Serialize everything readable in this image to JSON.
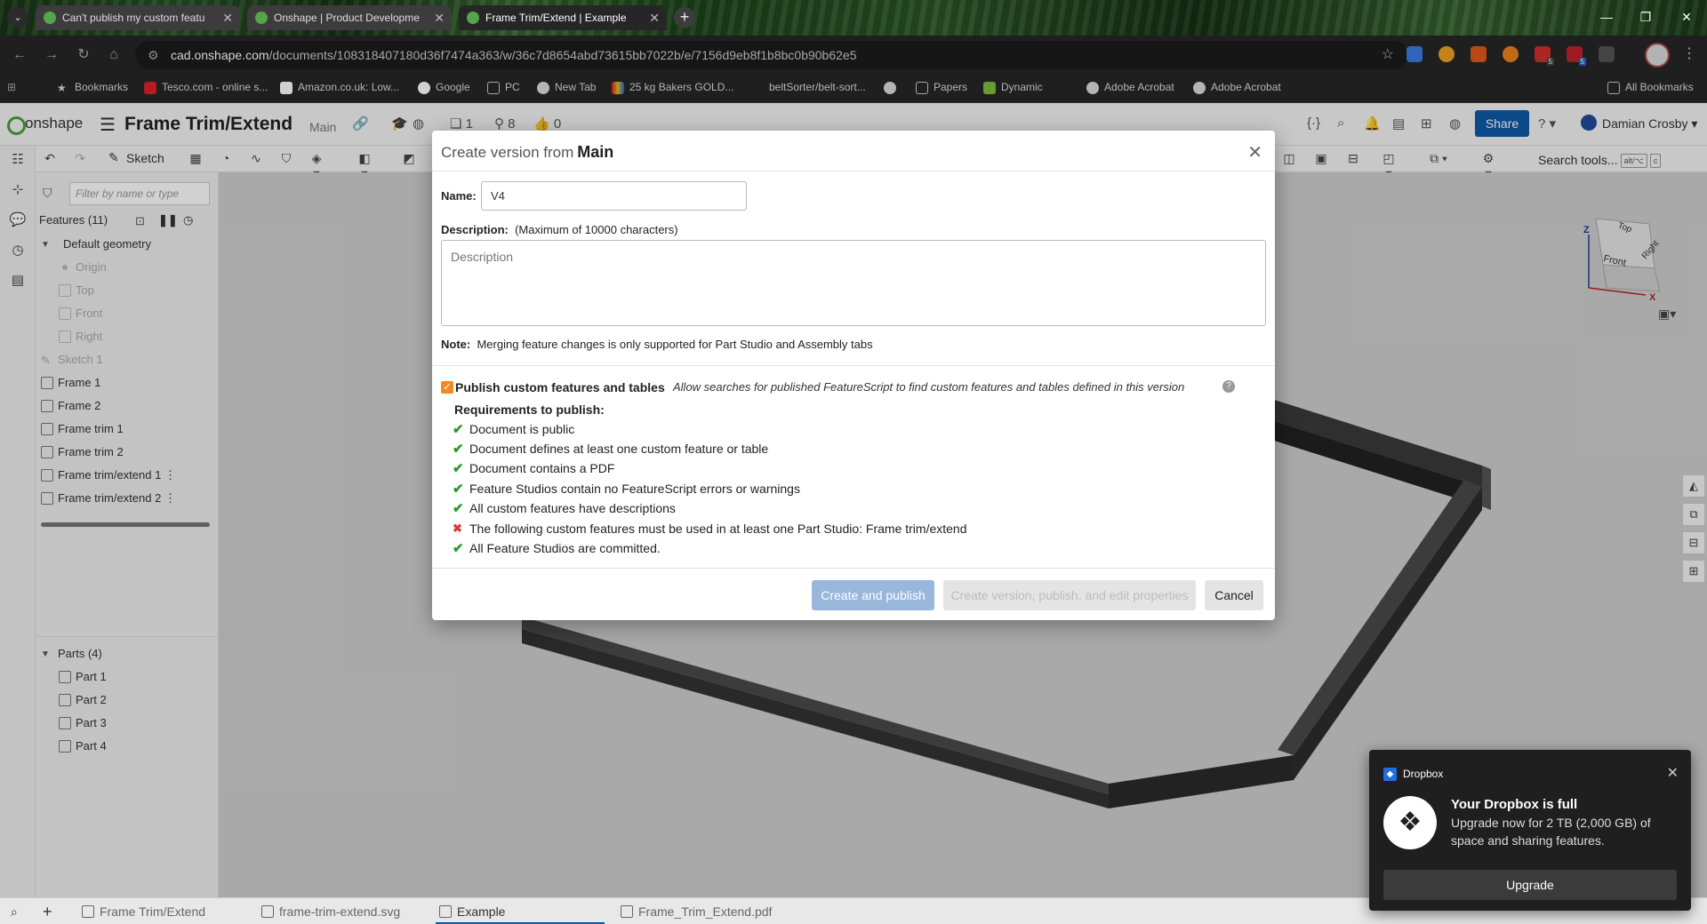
{
  "browser": {
    "tabs": [
      {
        "title": "Can't publish my custom featu"
      },
      {
        "title": "Onshape | Product Developme"
      },
      {
        "title": "Frame Trim/Extend | Example"
      }
    ],
    "url_host": "cad.onshape.com",
    "url_path": "/documents/108318407180d36f7474a363/w/36c7d8654abd73615bb7022b/e/7156d9eb8f1b8bc0b90b62e5",
    "extension_badges": [
      "5",
      "5"
    ],
    "bookmarks": [
      "Bookmarks",
      "Tesco.com - online s...",
      "Amazon.co.uk: Low...",
      "Google",
      "PC",
      "New Tab",
      "25 kg Bakers GOLD...",
      "beltSorter/belt-sort...",
      "Papers",
      "Dynamic",
      "Adobe Acrobat",
      "Adobe Acrobat",
      "All Bookmarks"
    ]
  },
  "onshape": {
    "logo": "onshape",
    "doc_title": "Frame Trim/Extend",
    "branch": "Main",
    "counts": {
      "versions": "1",
      "users": "8",
      "likes": "0"
    },
    "share_label": "Share",
    "user": "Damian Crosby",
    "sketch_label": "Sketch",
    "search_tools": "Search tools...",
    "search_kbd": [
      "alt/⌥",
      "c"
    ]
  },
  "feature_tree": {
    "filter_placeholder": "Filter by name or type",
    "features_header": "Features (11)",
    "default_geometry": "Default geometry",
    "default_items": [
      "Origin",
      "Top",
      "Front",
      "Right"
    ],
    "features": [
      "Sketch 1",
      "Frame 1",
      "Frame 2",
      "Frame trim 1",
      "Frame trim 2",
      "Frame trim/extend 1",
      "Frame trim/extend 2"
    ],
    "parts_header": "Parts (4)",
    "parts": [
      "Part 1",
      "Part 2",
      "Part 3",
      "Part 4"
    ]
  },
  "view_cube": {
    "top": "Top",
    "front": "Front",
    "right": "Right",
    "axis_z": "Z",
    "axis_x": "X"
  },
  "dialog": {
    "title_prefix": "Create version from",
    "title_branch": "Main",
    "name_label": "Name:",
    "name_value": "V4",
    "description_label": "Description:",
    "description_hint": "(Maximum of 10000 characters)",
    "description_placeholder": "Description",
    "note_label": "Note:",
    "note_text": "Merging feature changes is only supported for Part Studio and Assembly tabs",
    "publish_label": "Publish custom features and tables",
    "publish_hint": "Allow searches for published FeatureScript to find custom features and tables defined in this version",
    "publish_checked": true,
    "requirements_title": "Requirements to publish:",
    "requirements": [
      {
        "text": "Document is public",
        "ok": true
      },
      {
        "text": "Document defines at least one custom feature or table",
        "ok": true
      },
      {
        "text": "Document contains a PDF",
        "ok": true
      },
      {
        "text": "Feature Studios contain no FeatureScript errors or warnings",
        "ok": true
      },
      {
        "text": "All custom features have descriptions",
        "ok": true
      },
      {
        "text": "The following custom features must be used in at least one Part Studio: Frame trim/extend",
        "ok": false
      },
      {
        "text": "All Feature Studios are committed.",
        "ok": true
      }
    ],
    "buttons": {
      "create_publish": "Create and publish",
      "create_publish_edit": "Create version, publish, and edit properties",
      "cancel": "Cancel"
    }
  },
  "bottom_tabs": [
    {
      "label": "Frame Trim/Extend"
    },
    {
      "label": "frame-trim-extend.svg"
    },
    {
      "label": "Example"
    },
    {
      "label": "Frame_Trim_Extend.pdf"
    }
  ],
  "toast": {
    "app": "Dropbox",
    "title": "Your Dropbox is full",
    "body": "Upgrade now for 2 TB (2,000 GB) of space and sharing features.",
    "button": "Upgrade"
  },
  "colors": {
    "share": "#0e5aa7",
    "primary_button": "#99b6db",
    "check_ok": "#2a9a2a",
    "check_bad": "#d23c3c",
    "checkbox": "#f08a24"
  }
}
